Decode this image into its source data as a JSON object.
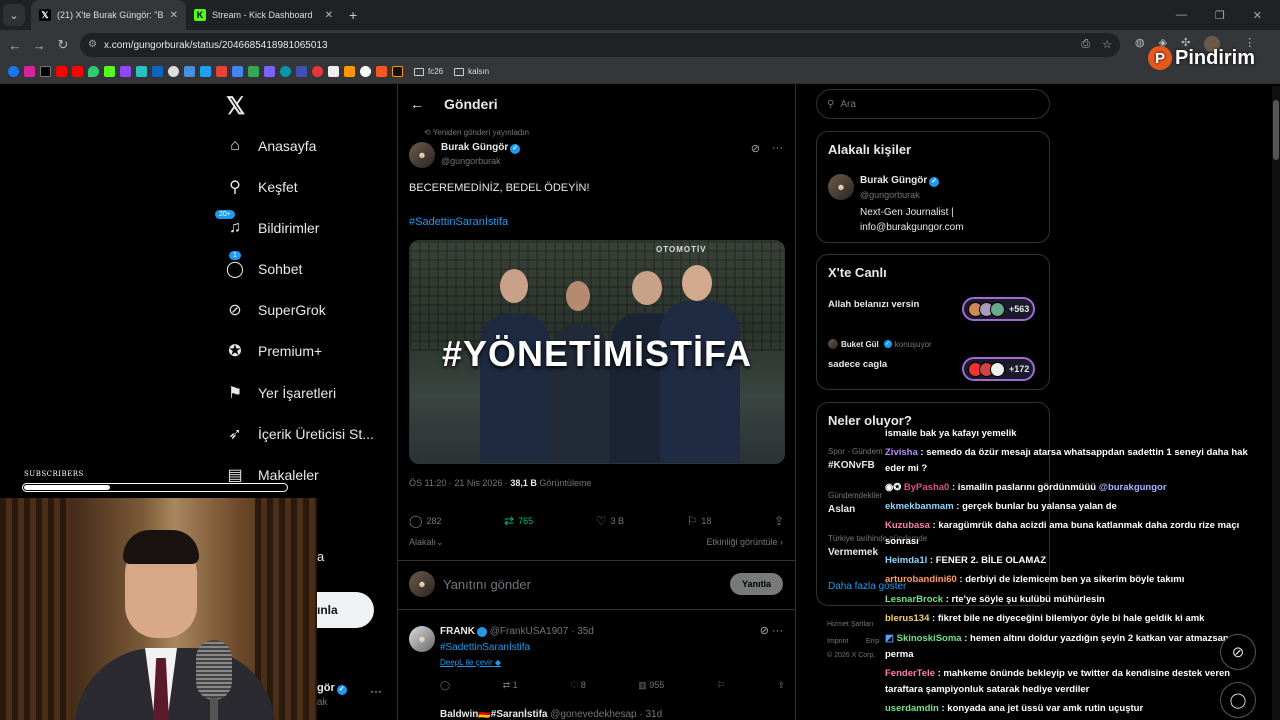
{
  "browser": {
    "tabs": [
      {
        "title": "(21) X'te Burak Güngör: \"BECER",
        "active": true
      },
      {
        "title": "Stream - Kick Dashboard",
        "active": false
      }
    ],
    "url": "x.com/gungorburak/status/2046685418981065013",
    "bookmark_folders": [
      "fc26",
      "kalsın"
    ]
  },
  "watermark": {
    "text": "Pindirim"
  },
  "nav": {
    "items": [
      {
        "label": "Anasayfa",
        "icon": "home-icon"
      },
      {
        "label": "Keşfet",
        "icon": "search-icon"
      },
      {
        "label": "Bildirimler",
        "icon": "bell-icon",
        "badge": "20+"
      },
      {
        "label": "Sohbet",
        "icon": "chat-icon",
        "badge": "1"
      },
      {
        "label": "SuperGrok",
        "icon": "grok-icon"
      },
      {
        "label": "Premium+",
        "icon": "premium-icon"
      },
      {
        "label": "Yer İşaretleri",
        "icon": "bookmark-icon"
      },
      {
        "label": "İçerik Üreticisi St...",
        "icon": "rocket-icon"
      },
      {
        "label": "Makaleler",
        "icon": "article-icon"
      }
    ],
    "partial_more": "a",
    "partial_post": "ınla",
    "partial_user": "gör",
    "partial_handle": "ak"
  },
  "post": {
    "header": "Gönderi",
    "reposted_note": "Yeniden gönderi yayınladın",
    "author": "Burak Güngör",
    "handle": "@gungorburak",
    "text": "BECEREMEDİNİZ, BEDEL ÖDEYİN!",
    "hashtag": "#SadettinSaranİstifa",
    "image_text": "#YÖNETİMİSTİFA",
    "image_sign": "OTOMOTİV",
    "time": "ÖS 11:20 · 21 Nis 2026 · ",
    "views": "38,1 B",
    "views_label": " Görüntüleme",
    "replies": "282",
    "reposts": "765",
    "likes": "3 B",
    "bookmarks": "18",
    "sort": "Alakalı",
    "activity": "Etkinliği görüntüle",
    "reply_placeholder": "Yanıtını gönder",
    "reply_button": "Yanıtla"
  },
  "reply1": {
    "name": "FRANK",
    "handle": "@FrankUSA1907 · 35d",
    "text": "#SadettinSaranİstifa",
    "translate": "DeepL ile çevir",
    "replies": "",
    "reposts": "1",
    "likes": "8",
    "views": "955"
  },
  "reply2": {
    "name": "Baldwin🇩🇪#Saranİstifa",
    "handle": "@gonevedekhesap · 31d"
  },
  "right": {
    "search_placeholder": "Ara",
    "relevant_title": "Alakalı kişiler",
    "relevant_name": "Burak Güngör",
    "relevant_handle": "@gungorburak",
    "relevant_bio1": "Next-Gen Journalist |",
    "relevant_bio2": "info@burakgungor.com",
    "live_title": "X'te Canlı",
    "live1_title": "Allah belanızı versin",
    "live1_count": "+563",
    "live2_host": "Buket Gül",
    "live2_status": "konuşuyor",
    "live2_title": "sadece cagla",
    "live2_count": "+172",
    "trends_title": "Neler oluyor?",
    "trend1_cat": "Spor · Gündem",
    "trend1": "#KONvFB",
    "trend2_cat": "Gündemdekiler",
    "trend2": "Aslan",
    "trend3_cat": "Türkiye tarihinde gündemde",
    "trend3": "Vermemek",
    "trends_more": "Daha fazla göster",
    "footer1": "Hizmet Şartları",
    "footer2": "Imprint",
    "footer3": "Erişi",
    "footer4": "© 2026 X Corp."
  },
  "overlay": {
    "subscribers_label": "SUBSCRIBERS",
    "subscribers_progress": 0.33
  },
  "chat": [
    {
      "user": "",
      "msg": "ismaile bak ya kafayı yemelik",
      "color": "#ffffff"
    },
    {
      "user": "Zivisha",
      "msg": " : semedo da özür mesajı atarsa whatsappdan sadettin 1 seneyi daha hak",
      "color": "#b98cff"
    },
    {
      "user": "",
      "msg": "eder mi ?",
      "color": "#ffffff"
    },
    {
      "user": "ByPasha0",
      "msg": " : ismailin paslarını gördünmüüü ",
      "mention": "@burakgungor",
      "color": "#e0508a"
    },
    {
      "user": "ekmekbanmam",
      "msg": " : gerçek bunlar bu yalansa yalan de",
      "color": "#8fd6ff"
    },
    {
      "user": "Kuzubasa",
      "msg": " : karagümrük daha acizdi ama buna katlanmak daha zordu rize maçı",
      "color": "#ff7eb0"
    },
    {
      "user": "",
      "msg": "sonrası",
      "color": "#ffffff"
    },
    {
      "user": "Heimda1l",
      "msg": " : FENER 2. BİLE OLAMAZ",
      "color": "#8fd6ff"
    },
    {
      "user": "arturobandini60",
      "msg": " : derbiyi de izlemicem ben ya sikerim böyle takımı",
      "color": "#ff9a5a"
    },
    {
      "user": "LesnarBrock",
      "msg": " : rte'ye söyle şu kulübü mühürlesin",
      "color": "#6fe28a"
    },
    {
      "user": "blerus134",
      "msg": " : fikret bile ne diyeceğini bilemiyor öyle bi hale geldik ki amk",
      "color": "#f2d16b"
    },
    {
      "user": "SkinoskiSoma",
      "msg": " : hemen altını doldur yazdığın şeyin 2 katkan var atmazsan",
      "color": "#6fe28a"
    },
    {
      "user": "",
      "msg": "perma",
      "color": "#ffffff"
    },
    {
      "user": "FenderTele",
      "msg": " : mahkeme önünde bekleyip ve twitter da kendisine destek veren",
      "color": "#ff7eb0"
    },
    {
      "user": "",
      "msg": "taraftara şampiyonluk satarak hediye verdiler",
      "color": "#ffffff"
    },
    {
      "user": "userdamdin",
      "msg": " : konyada ana jet üssü var amk rutin uçuştur",
      "color": "#6fe28a"
    }
  ]
}
